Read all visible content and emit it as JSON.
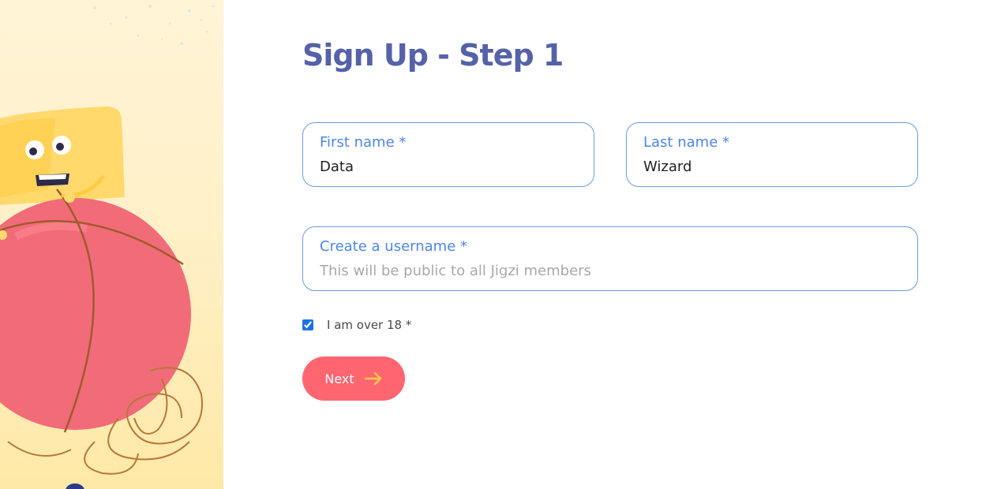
{
  "form": {
    "title": "Sign Up - Step 1",
    "first_name": {
      "label": "First name *",
      "value": "Data"
    },
    "last_name": {
      "label": "Last name *",
      "value": "Wizard"
    },
    "username": {
      "label": "Create a username *",
      "value": "",
      "placeholder": "This will be public to all Jigzi members"
    },
    "age_check": {
      "label": "I am over 18 *",
      "checked": true
    },
    "next_button": {
      "label": "Next",
      "icon": "arrow-right-icon"
    }
  },
  "colors": {
    "title": "#5562a8",
    "field_border": "#6e9be8",
    "field_label": "#4f86e6",
    "button_bg": "#ff6670",
    "button_arrow": "#ffc94d",
    "illustration_bg": "#fff0c8"
  }
}
